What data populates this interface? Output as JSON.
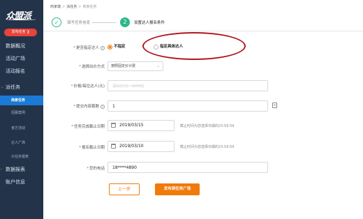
{
  "sidebar": {
    "logo_text": "众盟派",
    "publish_button": "发布任务 ❯",
    "menu": [
      {
        "label": "数据概况"
      },
      {
        "label": "活动广场"
      },
      {
        "label": "活动报名"
      },
      {
        "label": "派任务"
      }
    ],
    "sub_items": [
      {
        "label": "商家任务"
      },
      {
        "label": "招募案例"
      },
      {
        "label": "官方活动"
      },
      {
        "label": "达人广场"
      },
      {
        "label": "众任务报表"
      }
    ],
    "menu_bottom": [
      {
        "label": "数据报表"
      },
      {
        "label": "账户信息"
      }
    ]
  },
  "breadcrumb": {
    "items": [
      "商家端",
      "派任务",
      "商家任务"
    ]
  },
  "steps": {
    "step1_label": "填写任务信息",
    "step2_number": "2",
    "step2_label": "设置达人报名条件"
  },
  "form": {
    "talent_label": "是否指定达人",
    "talent_options": [
      {
        "label": "不指定",
        "checked": true
      },
      {
        "label": "指定具体达人",
        "checked": false
      }
    ],
    "pricing_label": "选择出价方式",
    "pricing_value": "按照固定价计费",
    "price_label": "价格/每位达人(元)",
    "price_placeholder": "请出价[50~99999]",
    "count_label": "提交内容篇数",
    "count_value": "1",
    "complete_label": "任务完成截止日期",
    "complete_date": "2019/03/15",
    "complete_hint": "截止时间为您选择日期的23:59:59",
    "signup_label": "报名截止日期",
    "signup_date": "2019/03/10",
    "signup_hint": "截止时间为您选择日期的23:59:59",
    "phone_label": "您的电话",
    "phone_value": "18****4890"
  },
  "buttons": {
    "prev": "上一步",
    "publish": "发布到任务广场"
  },
  "colors": {
    "accent": "#f07a0a",
    "sidebar_bg": "#23334a",
    "step_green": "#2eb886",
    "annotation_red": "#b0141a"
  }
}
